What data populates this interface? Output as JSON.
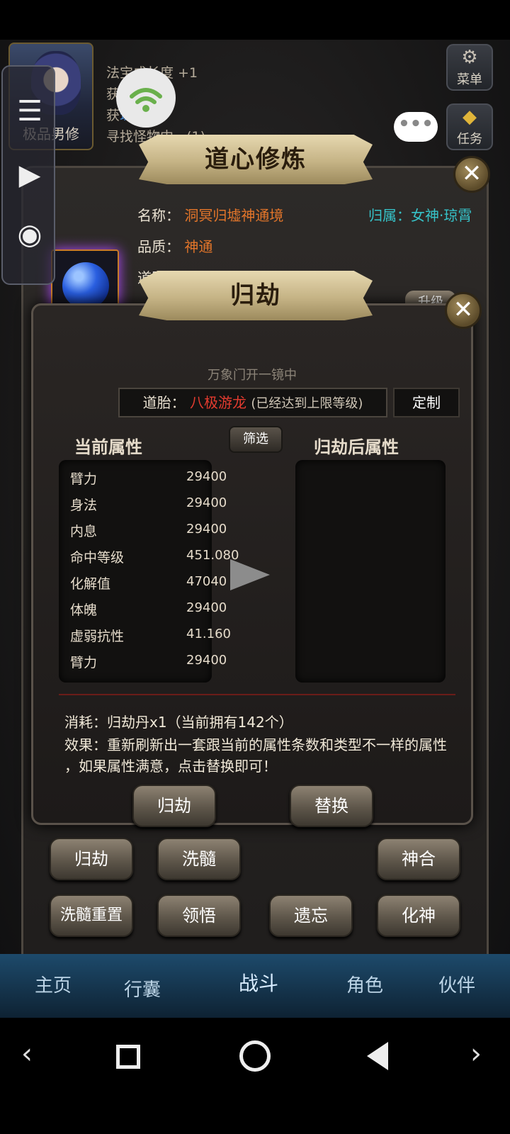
{
  "hud": {
    "avatar_label": "极品男修",
    "log_lines": [
      {
        "pre": "法宝成长度 +1",
        "hl": "",
        "post": ""
      },
      {
        "pre": "获",
        "hl": "",
        "post": "x3"
      },
      {
        "pre": "获",
        "hl": "珠",
        "post": "x2"
      },
      {
        "pre": "寻找怪物中...(1)",
        "hl": "",
        "post": ""
      }
    ],
    "menu_label": "菜单",
    "task_label": "任务"
  },
  "back_panel": {
    "title": "道心修炼",
    "name_label": "名称：",
    "name_value": "洞冥归墟神通境",
    "belong_label": "归属：",
    "belong_value": "女神·琼霄",
    "quality_label": "品质：",
    "quality_value": "神通",
    "daotai_label": "道胎：",
    "upgrade_label": "升级",
    "buttons": [
      "归劫",
      "洗髓",
      "神合",
      "洗髓重置",
      "领悟",
      "遗忘",
      "化神"
    ]
  },
  "front_panel": {
    "title": "归劫",
    "subtitle": "万象门开一镜中",
    "daotai_label": "道胎：",
    "daotai_value": "八极游龙",
    "daotai_note": "(已经达到上限等级)",
    "custom_label": "定制",
    "current_title": "当前属性",
    "after_title": "归劫后属性",
    "filter_label": "筛选",
    "attributes": [
      {
        "name": "臂力",
        "value": "29400"
      },
      {
        "name": "身法",
        "value": "29400"
      },
      {
        "name": "内息",
        "value": "29400"
      },
      {
        "name": "命中等级",
        "value": "451.080"
      },
      {
        "name": "化解值",
        "value": "47040"
      },
      {
        "name": "体魄",
        "value": "29400"
      },
      {
        "name": "虚弱抗性",
        "value": "41.160"
      },
      {
        "name": "臂力",
        "value": "29400"
      }
    ],
    "cost_line": "消耗：归劫丹x1（当前拥有142个）",
    "effect_line1": "效果：重新刷新出一套跟当前的属性条数和类型不一样的属性",
    "effect_line2": "，如果属性满意，点击替换即可！",
    "guijie_button": "归劫",
    "replace_button": "替换"
  },
  "bottom_nav": [
    "主页",
    "行囊",
    "战斗",
    "角色",
    "伙伴"
  ]
}
